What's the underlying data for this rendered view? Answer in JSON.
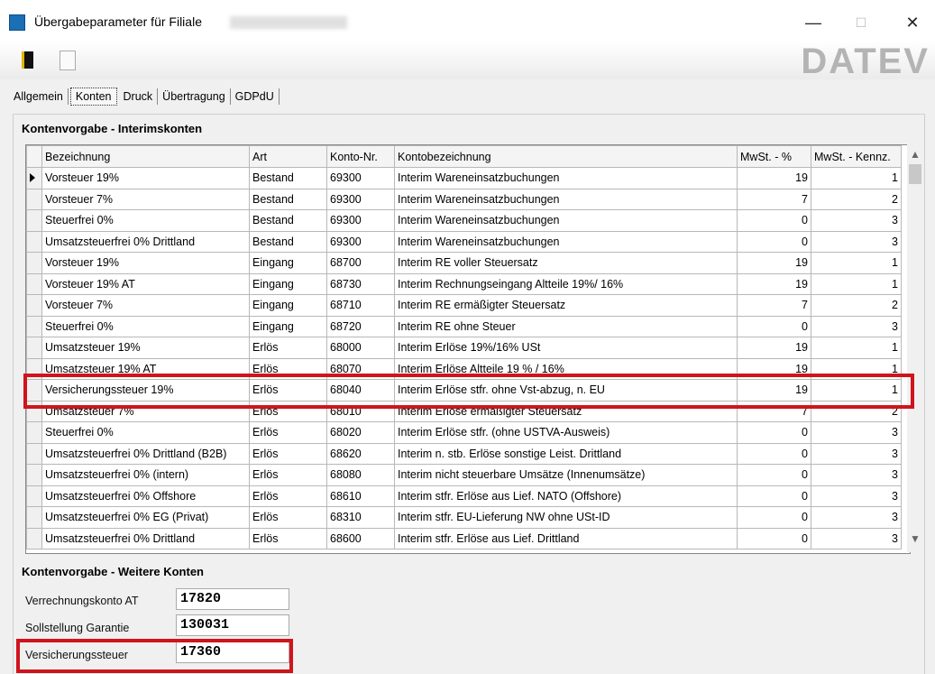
{
  "window": {
    "title": "Übergabeparameter für Filiale",
    "minimize_glyph": "—",
    "maximize_glyph": "☐",
    "close_glyph": "✕",
    "logo_text": "DATEV"
  },
  "tabs": [
    "Allgemein",
    "Konten",
    "Druck",
    "Übertragung",
    "GDPdU"
  ],
  "active_tab": "Konten",
  "interim": {
    "heading": "Kontenvorgabe - Interimskonten",
    "columns": [
      "Bezeichnung",
      "Art",
      "Konto-Nr.",
      "Kontobezeichnung",
      "MwSt. - %",
      "MwSt. - Kennz."
    ],
    "rows": [
      [
        "Vorsteuer 19%",
        "Bestand",
        "69300",
        "Interim Wareneinsatzbuchungen",
        "19",
        "1"
      ],
      [
        "Vorsteuer 7%",
        "Bestand",
        "69300",
        "Interim Wareneinsatzbuchungen",
        "7",
        "2"
      ],
      [
        "Steuerfrei 0%",
        "Bestand",
        "69300",
        "Interim Wareneinsatzbuchungen",
        "0",
        "3"
      ],
      [
        "Umsatzsteuerfrei 0% Drittland",
        "Bestand",
        "69300",
        "Interim Wareneinsatzbuchungen",
        "0",
        "3"
      ],
      [
        "Vorsteuer 19%",
        "Eingang",
        "68700",
        "Interim RE voller Steuersatz",
        "19",
        "1"
      ],
      [
        "Vorsteuer 19% AT",
        "Eingang",
        "68730",
        "Interim Rechnungseingang Altteile 19%/ 16%",
        "19",
        "1"
      ],
      [
        "Vorsteuer 7%",
        "Eingang",
        "68710",
        "Interim RE ermäßigter Steuersatz",
        "7",
        "2"
      ],
      [
        "Steuerfrei 0%",
        "Eingang",
        "68720",
        "Interim RE ohne Steuer",
        "0",
        "3"
      ],
      [
        "Umsatzsteuer 19%",
        "Erlös",
        "68000",
        "Interim Erlöse 19%/16% USt",
        "19",
        "1"
      ],
      [
        "Umsatzsteuer 19% AT",
        "Erlös",
        "68070",
        "Interim Erlöse Altteile 19 % / 16%",
        "19",
        "1"
      ],
      [
        "Versicherungssteuer 19%",
        "Erlös",
        "68040",
        "Interim Erlöse stfr. ohne Vst-abzug, n. EU",
        "19",
        "1"
      ],
      [
        "Umsatzsteuer 7%",
        "Erlös",
        "68010",
        "Interim Erlöse ermäßigter Steuersatz",
        "7",
        "2"
      ],
      [
        "Steuerfrei 0%",
        "Erlös",
        "68020",
        "Interim Erlöse stfr. (ohne USTVA-Ausweis)",
        "0",
        "3"
      ],
      [
        "Umsatzsteuerfrei 0% Drittland (B2B)",
        "Erlös",
        "68620",
        "Interim n. stb. Erlöse sonstige Leist. Drittland",
        "0",
        "3"
      ],
      [
        "Umsatzsteuerfrei 0% (intern)",
        "Erlös",
        "68080",
        "Interim nicht steuerbare Umsätze (Innenumsätze)",
        "0",
        "3"
      ],
      [
        "Umsatzsteuerfrei 0% Offshore",
        "Erlös",
        "68610",
        "Interim stfr. Erlöse aus Lief. NATO (Offshore)",
        "0",
        "3"
      ],
      [
        "Umsatzsteuerfrei 0% EG (Privat)",
        "Erlös",
        "68310",
        "Interim stfr. EU-Lieferung NW ohne USt-ID",
        "0",
        "3"
      ],
      [
        "Umsatzsteuerfrei 0% Drittland",
        "Erlös",
        "68600",
        "Interim stfr. Erlöse aus Lief. Drittland",
        "0",
        "3"
      ]
    ],
    "current_row": 0,
    "highlighted_row": 10,
    "scroll_up_glyph": "▲",
    "scroll_down_glyph": "▼"
  },
  "further": {
    "heading": "Kontenvorgabe - Weitere Konten",
    "fields": [
      {
        "label": "Verrechnungskonto AT",
        "value": "17820"
      },
      {
        "label": "Sollstellung Garantie",
        "value": "130031"
      },
      {
        "label": "Versicherungssteuer",
        "value": "17360"
      }
    ]
  },
  "colors": {
    "highlight": "#d0141b",
    "app_icon": "#1a6fb5",
    "logo": "#b4b4b4"
  }
}
